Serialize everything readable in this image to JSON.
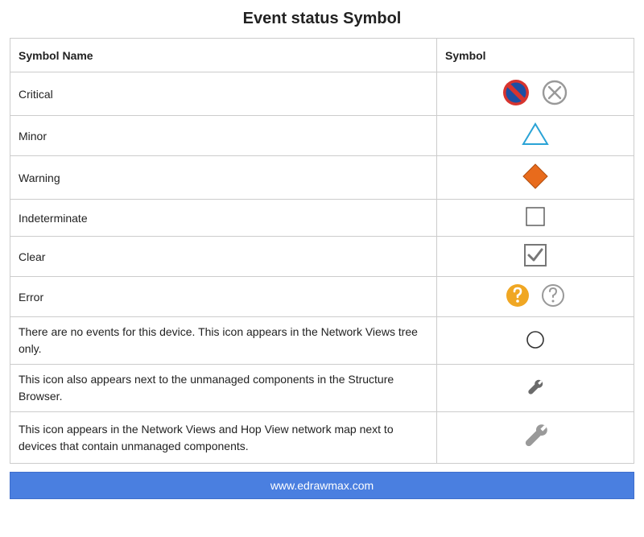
{
  "title": "Event status Symbol",
  "headers": {
    "name": "Symbol Name",
    "symbol": "Symbol"
  },
  "rows": [
    {
      "label": "Critical"
    },
    {
      "label": "Minor"
    },
    {
      "label": "Warning"
    },
    {
      "label": "Indeterminate"
    },
    {
      "label": "Clear"
    },
    {
      "label": "Error"
    },
    {
      "label": "There are no events for this device. This icon appears in the Network Views tree only."
    },
    {
      "label": "This icon also appears next to the unmanaged components in the Structure Browser."
    },
    {
      "label": "This icon appears in the Network Views and Hop View network map next to devices that contain unmanaged components."
    }
  ],
  "footer": "www.edrawmax.com",
  "colors": {
    "critical_fill": "#d7342f",
    "critical_inner": "#1d4fa3",
    "ghost_stroke": "#999999",
    "minor_stroke": "#2aa3d6",
    "warning_fill": "#e86b1c",
    "indeterminate_stroke": "#555555",
    "clear_stroke": "#777777",
    "error_fill": "#f0a723",
    "wrench": "#6b6b6b",
    "wrench_light": "#9a9a9a",
    "footer_bg": "#4a7fe0"
  }
}
